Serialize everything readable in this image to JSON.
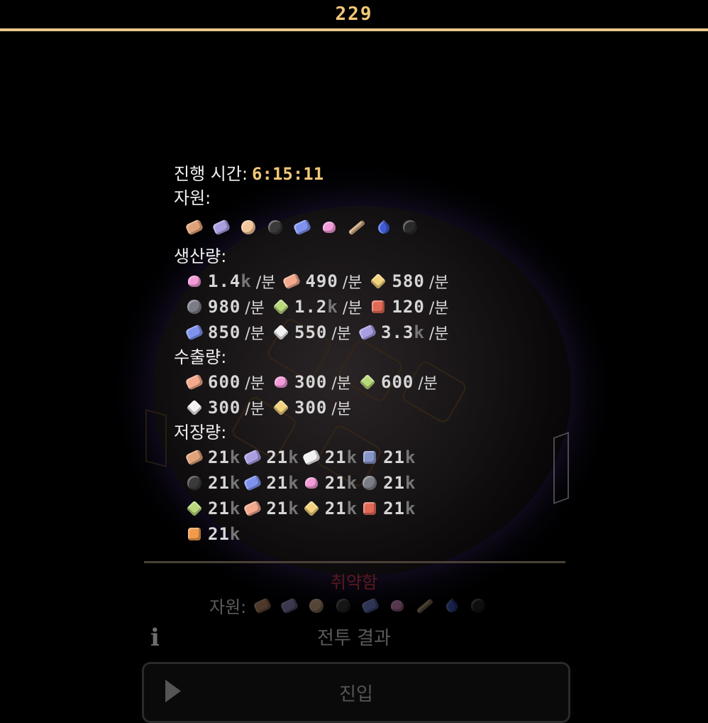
{
  "top": {
    "turn": "229"
  },
  "tooltip": {
    "elapsed_label": "진행 시간:",
    "elapsed_value": "6:15:11",
    "resources_label": "자원:",
    "resources_icons": [
      {
        "name": "copper-bar-icon",
        "color": "#e0a27a",
        "shape": "bar"
      },
      {
        "name": "lavender-bar-icon",
        "color": "#a99ee0",
        "shape": "bar"
      },
      {
        "name": "peach-nugget-icon",
        "color": "#f2c69a",
        "shape": "round"
      },
      {
        "name": "coal-icon",
        "color": "#3a3a3a",
        "shape": "round"
      },
      {
        "name": "blue-crystal-icon",
        "color": "#7f93ee",
        "shape": "bar"
      },
      {
        "name": "pink-heart-icon",
        "color": "#f39ad8",
        "shape": "heart"
      },
      {
        "name": "stick-icon",
        "color": "#c9a57b",
        "shape": "stick"
      },
      {
        "name": "water-drop-icon",
        "color": "#3f5cd6",
        "shape": "drop"
      },
      {
        "name": "bomb-icon",
        "color": "#2a2a2a",
        "shape": "round"
      }
    ],
    "production_label": "생산량:",
    "production_rows": [
      [
        {
          "icon": "pink-heart-icon",
          "color": "#f39ad8",
          "shape": "heart",
          "value": "1.4",
          "suffix": "k",
          "unit": "/분"
        },
        {
          "icon": "striped-bar-icon",
          "color": "#f2a98c",
          "shape": "bar",
          "value": "490",
          "suffix": "",
          "unit": "/분"
        },
        {
          "icon": "gold-diamond-icon",
          "color": "#f2d27c",
          "shape": "diamond",
          "value": "580",
          "suffix": "",
          "unit": "/분"
        }
      ],
      [
        {
          "icon": "gray-ore-icon",
          "color": "#7c7c86",
          "shape": "round",
          "value": "980",
          "suffix": "",
          "unit": "/분"
        },
        {
          "icon": "green-gem-icon",
          "color": "#b9d87a",
          "shape": "diamond",
          "value": "1.2",
          "suffix": "k",
          "unit": "/분"
        },
        {
          "icon": "red-ore-icon",
          "color": "#e06a56",
          "shape": "square",
          "value": "120",
          "suffix": "",
          "unit": "/분"
        }
      ],
      [
        {
          "icon": "blue-crystal-icon",
          "color": "#7f93ee",
          "shape": "bar",
          "value": "850",
          "suffix": "",
          "unit": "/분"
        },
        {
          "icon": "white-crystal-icon",
          "color": "#f2f2f2",
          "shape": "diamond",
          "value": "550",
          "suffix": "",
          "unit": "/분"
        },
        {
          "icon": "lavender-bar-icon",
          "color": "#a99ee0",
          "shape": "bar",
          "value": "3.3",
          "suffix": "k",
          "unit": "/분"
        }
      ]
    ],
    "export_label": "수출량:",
    "export_rows": [
      [
        {
          "icon": "striped-bar-icon",
          "color": "#f2a98c",
          "shape": "bar",
          "value": "600",
          "unit": "/분"
        },
        {
          "icon": "pink-heart-icon",
          "color": "#f39ad8",
          "shape": "heart",
          "value": "300",
          "unit": "/분"
        },
        {
          "icon": "green-gem-icon",
          "color": "#b9d87a",
          "shape": "diamond",
          "value": "600",
          "unit": "/분"
        }
      ],
      [
        {
          "icon": "white-crystal-icon",
          "color": "#f2f2f2",
          "shape": "diamond",
          "value": "300",
          "unit": "/분"
        },
        {
          "icon": "gold-diamond-icon",
          "color": "#f2d27c",
          "shape": "diamond",
          "value": "300",
          "unit": "/분"
        }
      ]
    ],
    "storage_label": "저장량:",
    "storage_rows": [
      [
        {
          "icon": "copper-bar-icon",
          "color": "#e0a27a",
          "shape": "bar",
          "value": "21",
          "suffix": "k"
        },
        {
          "icon": "lavender-bar-icon",
          "color": "#a99ee0",
          "shape": "bar",
          "value": "21",
          "suffix": "k"
        },
        {
          "icon": "white-crystal-icon",
          "color": "#f2f2f2",
          "shape": "bar",
          "value": "21",
          "suffix": "k"
        },
        {
          "icon": "blue-block-icon",
          "color": "#8796c8",
          "shape": "square",
          "value": "21",
          "suffix": "k"
        }
      ],
      [
        {
          "icon": "coal-icon",
          "color": "#3a3a3a",
          "shape": "round",
          "value": "21",
          "suffix": "k"
        },
        {
          "icon": "blue-crystal-icon",
          "color": "#7f93ee",
          "shape": "bar",
          "value": "21",
          "suffix": "k"
        },
        {
          "icon": "pink-heart-icon",
          "color": "#f39ad8",
          "shape": "heart",
          "value": "21",
          "suffix": "k"
        },
        {
          "icon": "gray-ore-icon",
          "color": "#7c7c86",
          "shape": "round",
          "value": "21",
          "suffix": "k"
        }
      ],
      [
        {
          "icon": "green-gem-icon",
          "color": "#b9d87a",
          "shape": "diamond",
          "value": "21",
          "suffix": "k"
        },
        {
          "icon": "striped-bar-icon",
          "color": "#f2a98c",
          "shape": "bar",
          "value": "21",
          "suffix": "k"
        },
        {
          "icon": "gold-diamond-icon",
          "color": "#f2d27c",
          "shape": "diamond",
          "value": "21",
          "suffix": "k"
        },
        {
          "icon": "red-ore-icon",
          "color": "#e06a56",
          "shape": "square",
          "value": "21",
          "suffix": "k"
        }
      ],
      [
        {
          "icon": "orange-ore-icon",
          "color": "#f09a4a",
          "shape": "square",
          "value": "21",
          "suffix": "k"
        }
      ]
    ]
  },
  "planet_panel": {
    "status": "취약함",
    "resources_label": "자원:",
    "battle_result": "전투 결과",
    "enter_button": "진입"
  },
  "colors": {
    "accent": "#f2c879",
    "topline": "#e8c88a"
  }
}
